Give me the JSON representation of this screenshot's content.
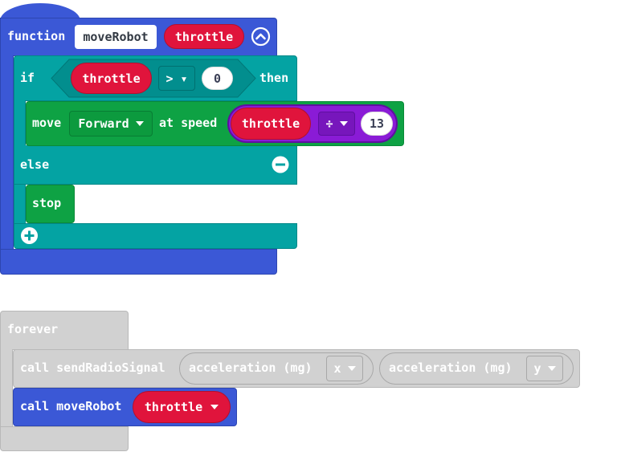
{
  "function_block": {
    "keyword": "function",
    "name": "moveRobot",
    "param": "throttle",
    "if_label": "if",
    "condition": {
      "left": "throttle",
      "operator": "> ▾",
      "right": "0"
    },
    "then_label": "then",
    "move_label": "move",
    "direction": "Forward",
    "at_speed_label": "at speed",
    "speed_expr": {
      "left": "throttle",
      "operator": "÷",
      "right": "13"
    },
    "else_label": "else",
    "stop_label": "stop"
  },
  "forever_block": {
    "keyword": "forever",
    "call1": {
      "label": "call sendRadioSignal",
      "arg1": "acceleration (mg)",
      "arg1_axis": "x",
      "arg2": "acceleration (mg)",
      "arg2_axis": "y"
    },
    "call2": {
      "label": "call moveRobot",
      "arg": "throttle"
    }
  },
  "icons": [
    "collapse-icon",
    "remove-else-icon",
    "add-else-icon"
  ],
  "colors": {
    "functions_blue": "#3b58d6",
    "logic_teal": "#04a3a3",
    "motion_green": "#0ea244",
    "variable_red": "#e0143c",
    "math_purple": "#8a1bd6",
    "disabled_grey": "#d1d1d1"
  }
}
